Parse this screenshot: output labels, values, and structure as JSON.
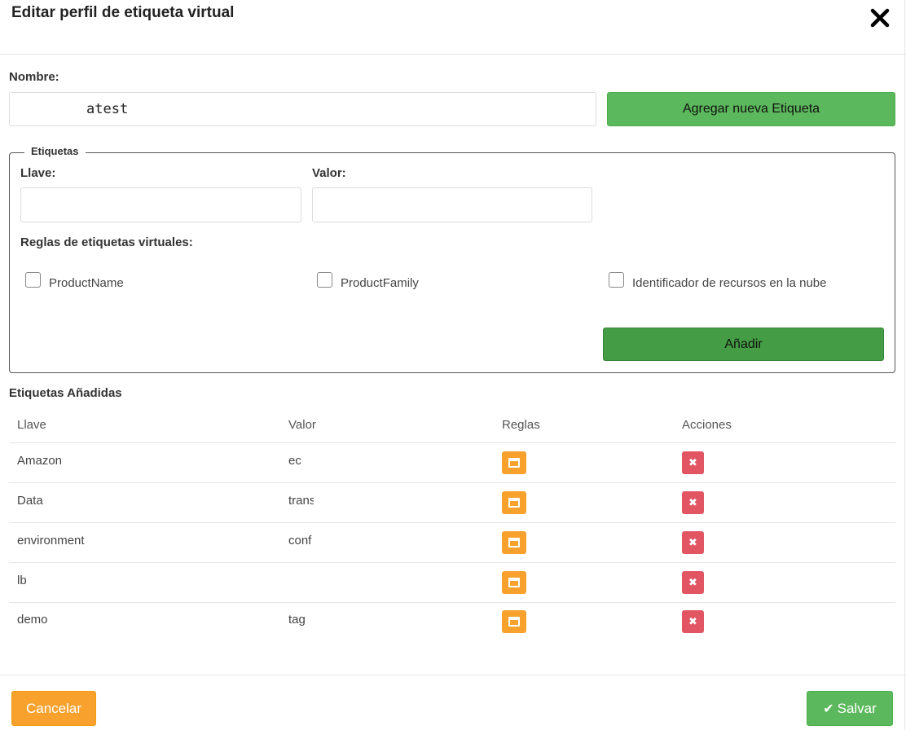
{
  "modal": {
    "title": "Editar perfil de etiqueta virtual",
    "close_icon": "close-icon"
  },
  "form": {
    "name_label": "Nombre:",
    "name_value": "atest",
    "add_tag_button": "Agregar nueva Etiqueta"
  },
  "tags_section": {
    "legend": "Etiquetas",
    "key_label": "Llave:",
    "key_value": "",
    "value_label": "Valor:",
    "value_value": "",
    "rules_label": "Reglas de etiquetas virtuales:",
    "rules": [
      {
        "label": "ProductName",
        "checked": false
      },
      {
        "label": "ProductFamily",
        "checked": false
      },
      {
        "label": "Identificador de recursos en la nube",
        "checked": false
      }
    ],
    "add_button": "Añadir"
  },
  "added_tags": {
    "title": "Etiquetas Añadidas",
    "columns": [
      "Llave",
      "Valor",
      "Reglas",
      "Acciones"
    ],
    "rows": [
      {
        "key": "Amazon",
        "value": "ec"
      },
      {
        "key": "Data",
        "value": "trans"
      },
      {
        "key": "environment",
        "value": "conf"
      },
      {
        "key": "lb",
        "value": ""
      },
      {
        "key": "demo",
        "value": "tag"
      }
    ],
    "rules_icon": "window-icon",
    "delete_icon": "times-icon",
    "delete_glyph": "✖"
  },
  "footer": {
    "cancel_label": "Cancelar",
    "save_label": "Salvar",
    "save_icon": "check-icon",
    "save_glyph": "✔"
  },
  "colors": {
    "green": "#5cb85c",
    "dark_green": "#449d44",
    "orange": "#f8a22d",
    "red": "#e25563"
  }
}
